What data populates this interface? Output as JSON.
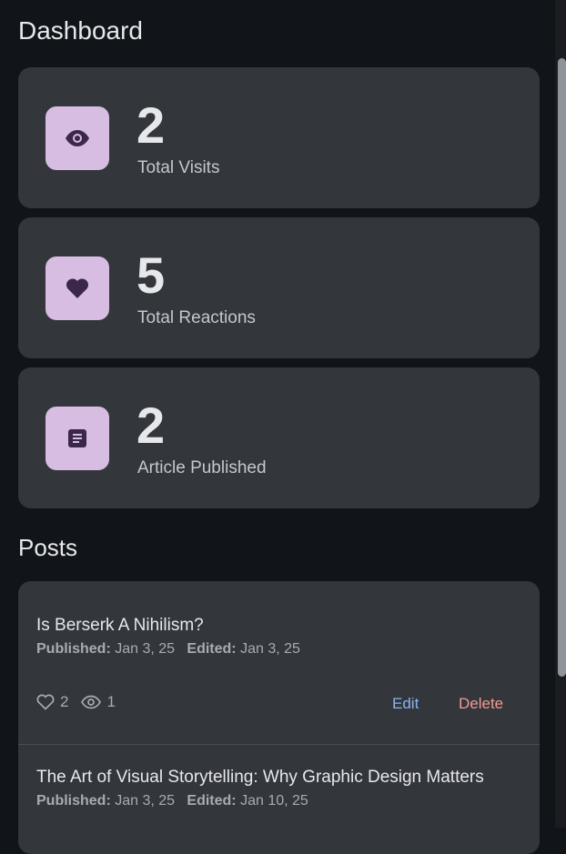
{
  "title": "Dashboard",
  "stats": [
    {
      "value": "2",
      "label": "Total Visits",
      "icon": "eye-icon"
    },
    {
      "value": "5",
      "label": "Total Reactions",
      "icon": "heart-icon"
    },
    {
      "value": "2",
      "label": "Article Published",
      "icon": "article-icon"
    }
  ],
  "posts_title": "Posts",
  "labels": {
    "published": "Published:",
    "edited": "Edited:",
    "edit": "Edit",
    "delete": "Delete"
  },
  "posts": [
    {
      "title": "Is Berserk A Nihilism?",
      "published": "Jan 3, 25",
      "edited": "Jan 3, 25",
      "likes": "2",
      "views": "1"
    },
    {
      "title": "The Art of Visual Storytelling: Why Graphic Design Matters",
      "published": "Jan 3, 25",
      "edited": "Jan 10, 25"
    }
  ],
  "colors": {
    "accent": "#d8bde2",
    "edit": "#8ab4f0",
    "delete": "#f29b93"
  }
}
